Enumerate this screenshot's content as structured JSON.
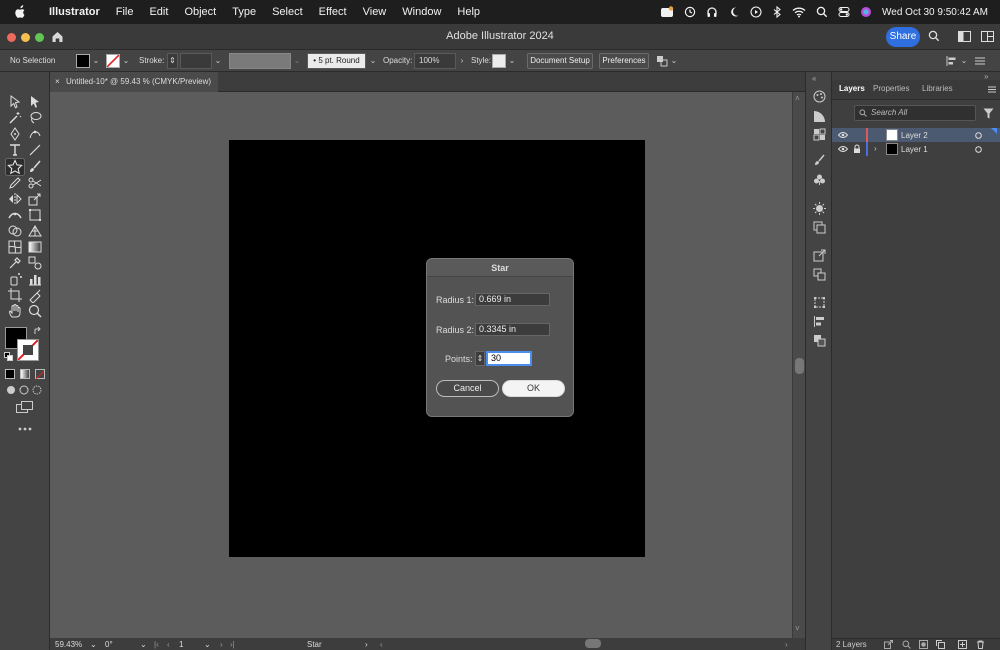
{
  "menubar": {
    "app_name": "Illustrator",
    "menus": [
      "File",
      "Edit",
      "Object",
      "Type",
      "Select",
      "Effect",
      "View",
      "Window",
      "Help"
    ],
    "datetime": "Wed Oct 30  9:50:42 AM"
  },
  "titlebar": {
    "title": "Adobe Illustrator 2024",
    "share_label": "Share"
  },
  "controlbar": {
    "selection_label": "No Selection",
    "stroke_label": "Stroke:",
    "brush_label": "5 pt. Round",
    "opacity_label": "Opacity:",
    "opacity_value": "100%",
    "style_label": "Style:",
    "document_setup_label": "Document Setup",
    "preferences_label": "Preferences"
  },
  "document_tab": {
    "close_glyph": "×",
    "title": "Untitled-10* @ 59.43 % (CMYK/Preview)"
  },
  "statusbar": {
    "zoom": "59.43%",
    "rotation": "0°",
    "artboard_number": "1",
    "current_tool": "Star"
  },
  "layers_panel": {
    "tabs": [
      "Layers",
      "Properties",
      "Libraries"
    ],
    "search_placeholder": "Search All",
    "layers": [
      {
        "name": "Layer 2",
        "color": "#e05a5a",
        "selected": true
      },
      {
        "name": "Layer 1",
        "color": "#4a6ee0",
        "selected": false
      }
    ],
    "footer_count": "2 Layers"
  },
  "star_dialog": {
    "title": "Star",
    "radius1_label": "Radius 1:",
    "radius1_value": "0.669 in",
    "radius2_label": "Radius 2:",
    "radius2_value": "0.3345 in",
    "points_label": "Points:",
    "points_value": "30",
    "cancel_label": "Cancel",
    "ok_label": "OK"
  },
  "colors": {
    "accent": "#2f6fe0",
    "artboard": "#000000",
    "canvas": "#5c5c5c"
  }
}
